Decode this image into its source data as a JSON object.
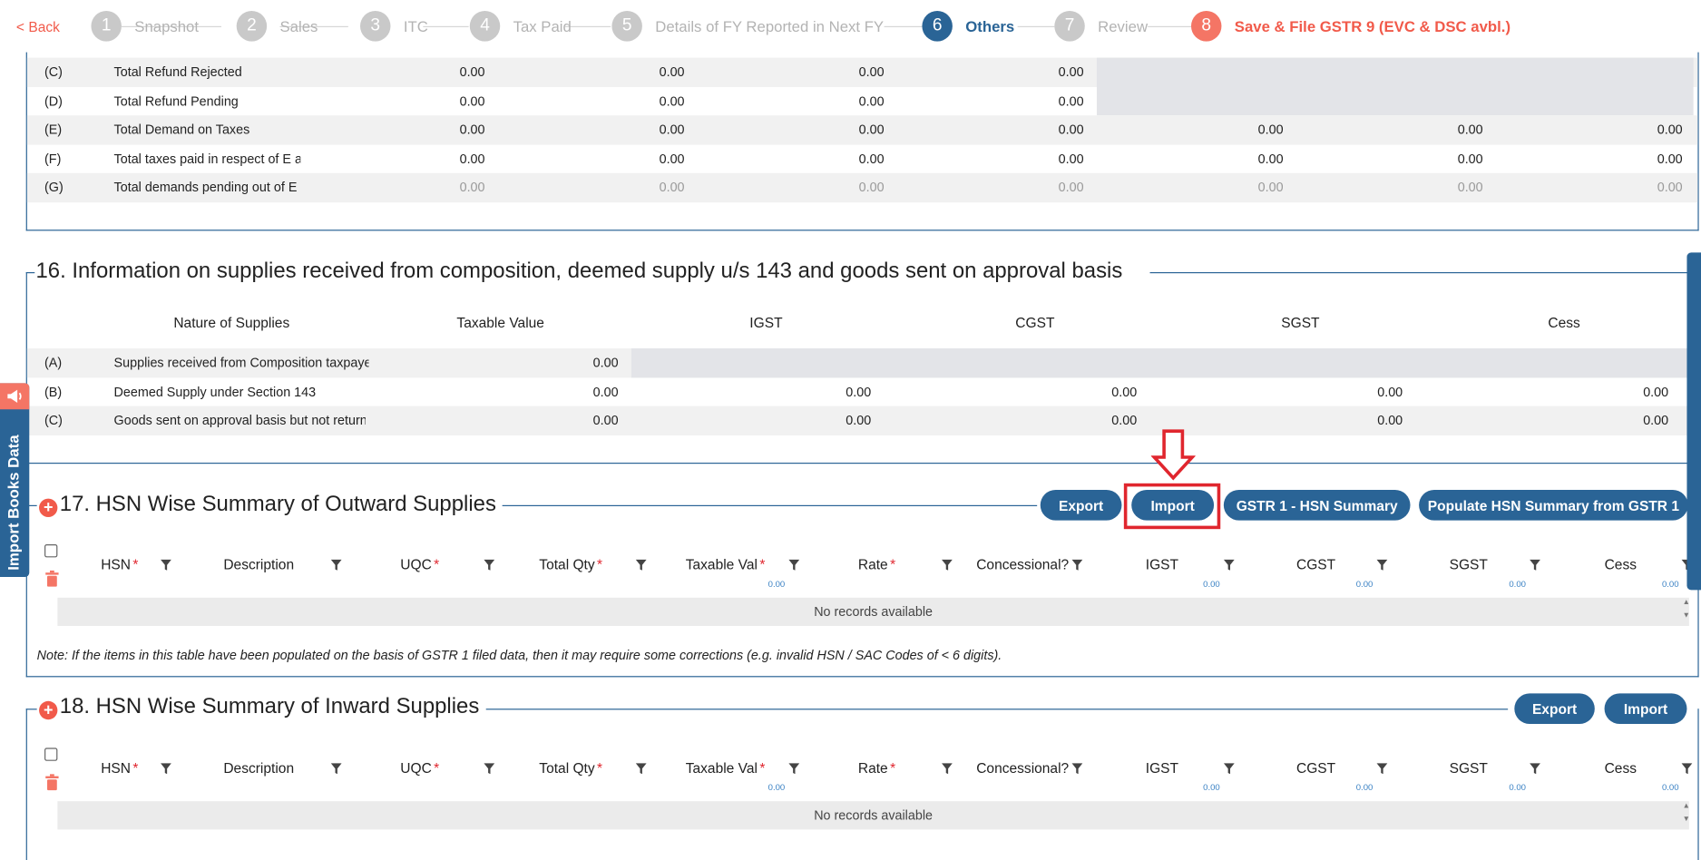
{
  "nav": {
    "back_label": "< Back",
    "steps": [
      {
        "num": "1",
        "label": "Snapshot"
      },
      {
        "num": "2",
        "label": "Sales"
      },
      {
        "num": "3",
        "label": "ITC"
      },
      {
        "num": "4",
        "label": "Tax Paid"
      },
      {
        "num": "5",
        "label": "Details of FY Reported in Next FY"
      },
      {
        "num": "6",
        "label": "Others"
      },
      {
        "num": "7",
        "label": "Review"
      },
      {
        "num": "8",
        "label": "Save & File GSTR 9 (EVC & DSC avbl.)"
      }
    ]
  },
  "sec15": {
    "rows": [
      {
        "code": "(C)",
        "label": "Total Refund Rejected",
        "vals": [
          "0.00",
          "0.00",
          "0.00",
          "0.00"
        ]
      },
      {
        "code": "(D)",
        "label": "Total Refund Pending",
        "vals": [
          "0.00",
          "0.00",
          "0.00",
          "0.00"
        ]
      },
      {
        "code": "(E)",
        "label": "Total Demand on Taxes",
        "vals": [
          "0.00",
          "0.00",
          "0.00",
          "0.00",
          "0.00",
          "0.00",
          "0.00"
        ]
      },
      {
        "code": "(F)",
        "label": "Total taxes paid in respect of E ab",
        "vals": [
          "0.00",
          "0.00",
          "0.00",
          "0.00",
          "0.00",
          "0.00",
          "0.00"
        ]
      },
      {
        "code": "(G)",
        "label": "Total demands pending out of E a",
        "vals": [
          "0.00",
          "0.00",
          "0.00",
          "0.00",
          "0.00",
          "0.00",
          "0.00"
        ]
      }
    ]
  },
  "sec16": {
    "title": "16. Information on supplies received from composition, deemed supply u/s 143 and goods sent on approval basis",
    "headers": [
      "Nature of Supplies",
      "Taxable Value",
      "IGST",
      "CGST",
      "SGST",
      "Cess"
    ],
    "rows": [
      {
        "code": "(A)",
        "label": "Supplies received from Composition taxpaye",
        "vals": [
          "0.00"
        ]
      },
      {
        "code": "(B)",
        "label": "Deemed Supply under Section 143",
        "vals": [
          "0.00",
          "0.00",
          "0.00",
          "0.00",
          "0.00"
        ]
      },
      {
        "code": "(C)",
        "label": "Goods sent on approval basis but not return",
        "vals": [
          "0.00",
          "0.00",
          "0.00",
          "0.00",
          "0.00"
        ]
      }
    ]
  },
  "sec17": {
    "title": "17. HSN Wise Summary of Outward Supplies",
    "buttons": [
      "Export",
      "Import",
      "GSTR 1 - HSN Summary",
      "Populate HSN Summary from GSTR 1"
    ],
    "columns": [
      "HSN",
      "Description",
      "UQC",
      "Total Qty",
      "Taxable Val",
      "Rate",
      "Concessional?",
      "IGST",
      "CGST",
      "SGST",
      "Cess"
    ],
    "totals": [
      "0.00",
      "0.00",
      "0.00",
      "0.00",
      "0.00"
    ],
    "empty": "No records available",
    "note": "Note: If the items in this table have been populated on the basis of GSTR 1 filed data, then it may require some corrections (e.g. invalid HSN / SAC Codes of < 6 digits)."
  },
  "sec18": {
    "title": "18. HSN Wise Summary of Inward Supplies",
    "buttons": [
      "Export",
      "Import"
    ],
    "columns": [
      "HSN",
      "Description",
      "UQC",
      "Total Qty",
      "Taxable Val",
      "Rate",
      "Concessional?",
      "IGST",
      "CGST",
      "SGST",
      "Cess"
    ],
    "totals": [
      "0.00",
      "0.00",
      "0.00",
      "0.00",
      "0.00"
    ],
    "empty": "No records available"
  },
  "side_tab": {
    "label": "Import Books Data"
  },
  "colors": {
    "primary": "#2a6496",
    "accent": "#f15a4a",
    "highlight": "#e0262e"
  }
}
